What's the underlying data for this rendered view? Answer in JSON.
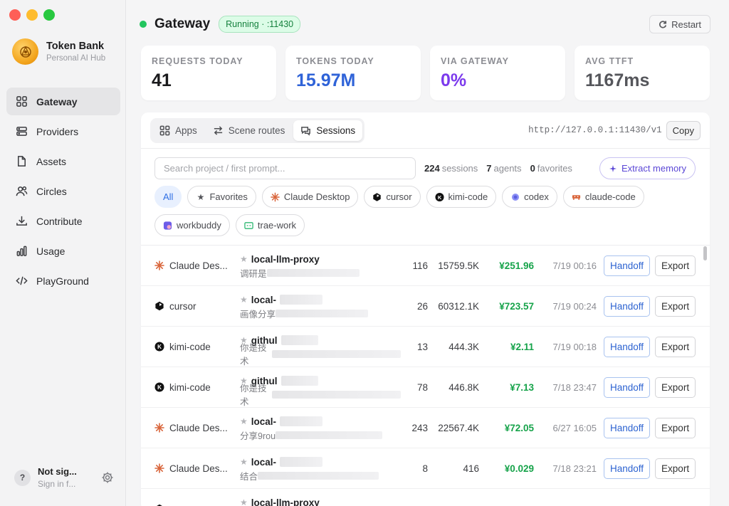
{
  "app": {
    "name": "Token Bank",
    "subtitle": "Personal AI Hub"
  },
  "sidebar": {
    "items": [
      {
        "label": "Gateway",
        "icon": "grid-icon",
        "active": true
      },
      {
        "label": "Providers",
        "icon": "server-icon"
      },
      {
        "label": "Assets",
        "icon": "file-icon"
      },
      {
        "label": "Circles",
        "icon": "users-icon"
      },
      {
        "label": "Contribute",
        "icon": "download-icon"
      },
      {
        "label": "Usage",
        "icon": "bar-chart-icon"
      },
      {
        "label": "PlayGround",
        "icon": "code-icon"
      }
    ],
    "account": {
      "avatar": "?",
      "name": "Not sig...",
      "sub": "Sign in f..."
    }
  },
  "header": {
    "title": "Gateway",
    "badge": "Running · :11430",
    "restart_label": "Restart"
  },
  "stats": [
    {
      "label": "REQUESTS TODAY",
      "value": "41",
      "color": "#1a1a1c"
    },
    {
      "label": "TOKENS TODAY",
      "value": "15.97M",
      "color": "#2f63d8"
    },
    {
      "label": "VIA GATEWAY",
      "value": "0%",
      "color": "#7c3aed"
    },
    {
      "label": "AVG TTFT",
      "value": "1167ms",
      "color": "#55565b"
    }
  ],
  "tabs": [
    {
      "label": "Apps",
      "icon": "grid-icon"
    },
    {
      "label": "Scene routes",
      "icon": "arrows-icon"
    },
    {
      "label": "Sessions",
      "icon": "chat-icon",
      "active": true
    }
  ],
  "endpoint": "http://127.0.0.1:11430/v1",
  "copy_label": "Copy",
  "search": {
    "placeholder": "Search project / first prompt..."
  },
  "counts": {
    "sessions_num": "224",
    "sessions_label": "sessions",
    "agents_num": "7",
    "agents_label": "agents",
    "favorites_num": "0",
    "favorites_label": "favorites"
  },
  "extract_label": "Extract memory",
  "filters": [
    {
      "label": "All",
      "active": true,
      "icon": ""
    },
    {
      "label": "Favorites",
      "icon": "star-icon"
    },
    {
      "label": "Claude Desktop",
      "icon": "claude-icon"
    },
    {
      "label": "cursor",
      "icon": "cursor-icon"
    },
    {
      "label": "kimi-code",
      "icon": "kimi-icon"
    },
    {
      "label": "codex",
      "icon": "codex-icon"
    },
    {
      "label": "claude-code",
      "icon": "claude-code-icon"
    },
    {
      "label": "workbuddy",
      "icon": "workbuddy-icon"
    },
    {
      "label": "trae-work",
      "icon": "trae-icon"
    }
  ],
  "actions": {
    "handoff": "Handoff",
    "export": "Export"
  },
  "sessions": [
    {
      "agent": "Claude Des...",
      "agent_icon": "claude-icon",
      "title": "local-llm-proxy",
      "sub": "调研是",
      "msgs": "116",
      "tokens": "15759.5K",
      "cost": "¥251.96",
      "time": "7/19 00:16"
    },
    {
      "agent": "cursor",
      "agent_icon": "cursor-icon",
      "title": "local-",
      "sub": "画像分享",
      "msgs": "26",
      "tokens": "60312.1K",
      "cost": "¥723.57",
      "time": "7/19 00:24"
    },
    {
      "agent": "kimi-code",
      "agent_icon": "kimi-icon",
      "title": "githul",
      "sub": "你是技术",
      "msgs": "13",
      "tokens": "444.3K",
      "cost": "¥2.11",
      "time": "7/19 00:18"
    },
    {
      "agent": "kimi-code",
      "agent_icon": "kimi-icon",
      "title": "githul",
      "sub": "你是技术",
      "msgs": "78",
      "tokens": "446.8K",
      "cost": "¥7.13",
      "time": "7/18 23:47"
    },
    {
      "agent": "Claude Des...",
      "agent_icon": "claude-icon",
      "title": "local-",
      "sub": "分享9rou",
      "msgs": "243",
      "tokens": "22567.4K",
      "cost": "¥72.05",
      "time": "6/27 16:05"
    },
    {
      "agent": "Claude Des...",
      "agent_icon": "claude-icon",
      "title": "local-",
      "sub": "结合",
      "msgs": "8",
      "tokens": "416",
      "cost": "¥0.029",
      "time": "7/18 23:21"
    },
    {
      "agent": "",
      "agent_icon": "cursor-icon",
      "title": "local-llm-proxy",
      "sub": "",
      "msgs": "",
      "tokens": "",
      "cost": "",
      "time": ""
    }
  ]
}
